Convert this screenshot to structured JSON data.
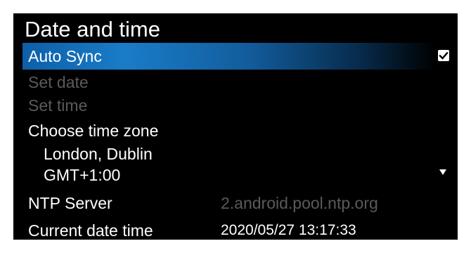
{
  "title": "Date and time",
  "items": {
    "auto_sync": {
      "label": "Auto Sync",
      "checked": true
    },
    "set_date": {
      "label": "Set date",
      "enabled": false
    },
    "set_time": {
      "label": "Set time",
      "enabled": false
    },
    "time_zone": {
      "label": "Choose time zone",
      "city": "London, Dublin",
      "offset": "GMT+1:00"
    },
    "ntp_server": {
      "label": "NTP Server",
      "value": "2.android.pool.ntp.org"
    },
    "current_datetime": {
      "label": "Current date time",
      "value": "2020/05/27 13:17:33"
    }
  },
  "icons": {
    "checkbox": "checkbox-checked-icon",
    "dropdown": "dropdown-arrow-icon"
  },
  "colors": {
    "background": "#000000",
    "highlight": "#1a7cc8",
    "text": "#ffffff",
    "disabled_text": "#5a5a5a",
    "ntp_value_text": "#5a5a5a"
  }
}
